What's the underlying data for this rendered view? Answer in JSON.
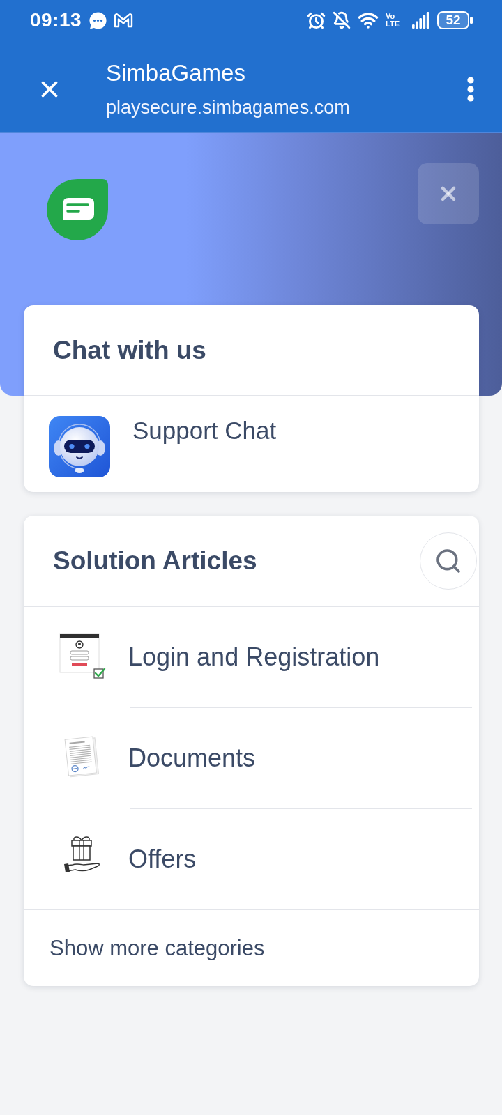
{
  "status_bar": {
    "time": "09:13",
    "network": {
      "top": "Vo",
      "bottom": "LTE"
    },
    "battery": "52"
  },
  "browser_bar": {
    "title": "SimbaGames",
    "url": "playsecure.simbagames.com"
  },
  "chat_card": {
    "title": "Chat with us",
    "items": [
      {
        "label": "Support Chat"
      }
    ]
  },
  "articles_card": {
    "title": "Solution Articles",
    "categories": [
      {
        "label": "Login and Registration",
        "kind": "login"
      },
      {
        "label": "Documents",
        "kind": "documents"
      },
      {
        "label": "Offers",
        "kind": "offers"
      }
    ],
    "show_more": "Show more categories"
  }
}
